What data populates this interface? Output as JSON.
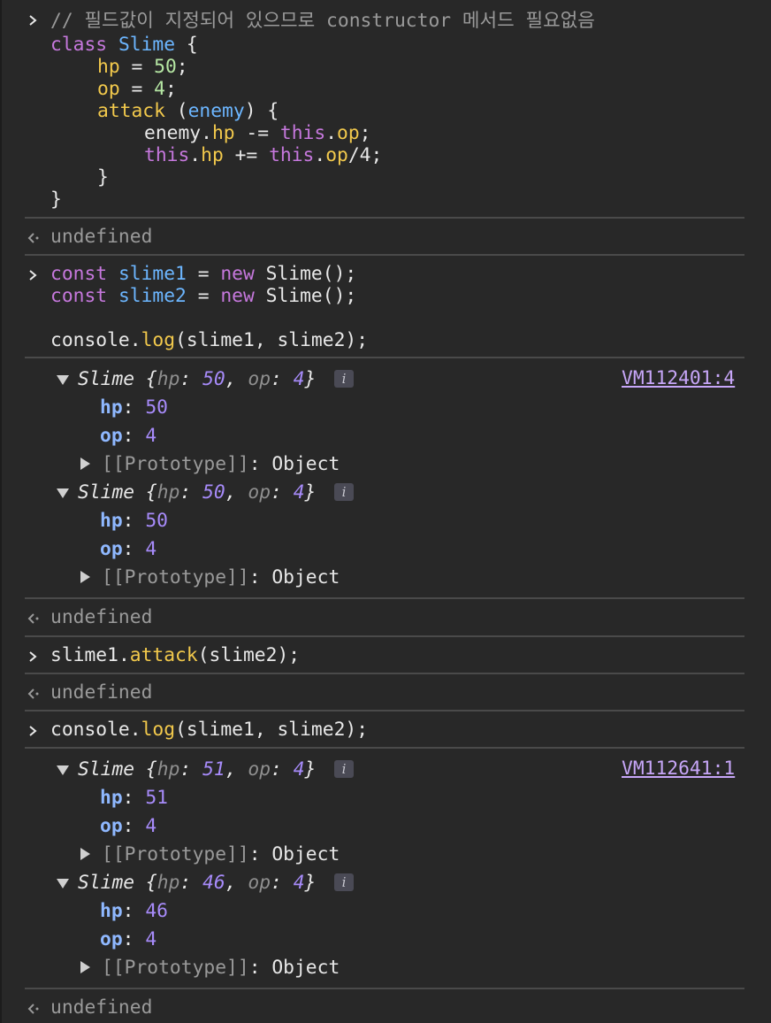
{
  "block1": {
    "comment": "// 필드값이 지정되어 있으므로 constructor 메서드 필요없음",
    "kw_class": "class",
    "class_name": "Slime",
    "brace_open": " {",
    "hp_prop": "hp",
    "hp_eq": " = ",
    "hp_val": "50",
    "semi": ";",
    "op_prop": "op",
    "op_val": "4",
    "attack": "attack",
    "paren_open": " (",
    "enemy": "enemy",
    "paren_close_brace": ") {",
    "enemy_text": "enemy",
    "dot": ".",
    "hp": "hp",
    "minus_eq": " -= ",
    "this": "this",
    "op": "op",
    "plus_eq": " += ",
    "div4": "/4",
    "close_inner": "}",
    "close_outer": "}"
  },
  "undefined_text": "undefined",
  "block2": {
    "const": "const",
    "slime1": "slime1",
    "slime2": "slime2",
    "eq": " = ",
    "new": "new",
    "ctor": " Slime();",
    "console": "console",
    "log": "log",
    "args": "(slime1, slime2);"
  },
  "block3": {
    "slime1": "slime1",
    "dot": ".",
    "attack": "attack",
    "args": "(slime2);"
  },
  "objects": {
    "slime_label": "Slime",
    "brace_open": " {",
    "hp_key": "hp",
    "op_key": "op",
    "colon": ": ",
    "comma": ", ",
    "brace_close": "}",
    "info": "i",
    "proto": "[[Prototype]]",
    "proto_val": "Object"
  },
  "out1": {
    "source": "VM112401:4",
    "a_hp": "50",
    "a_op": "4",
    "b_hp": "50",
    "b_op": "4"
  },
  "out2": {
    "source": "VM112641:1",
    "a_hp": "51",
    "a_op": "4",
    "b_hp": "46",
    "b_op": "4"
  }
}
